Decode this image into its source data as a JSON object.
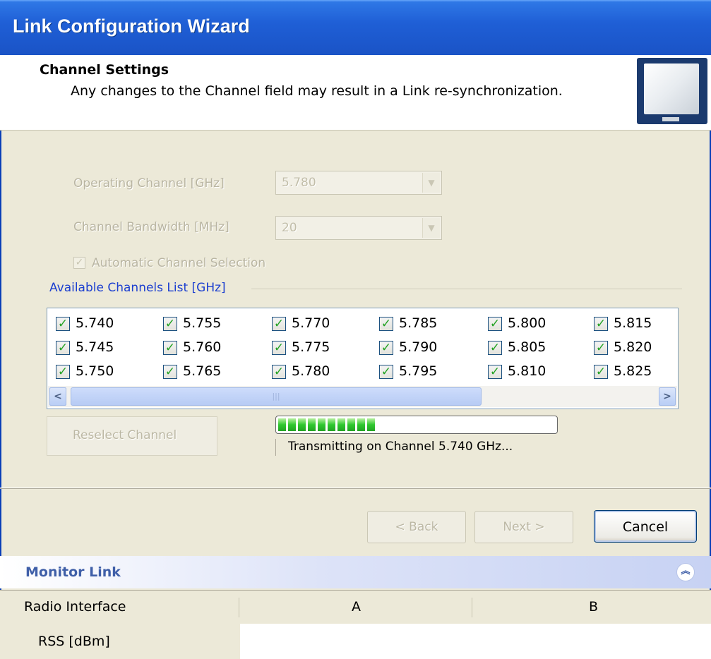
{
  "window": {
    "title": "Link Configuration Wizard"
  },
  "header": {
    "title": "Channel Settings",
    "subtitle": "Any changes to the Channel field may result in a Link re-synchronization."
  },
  "form": {
    "operating_channel_label": "Operating Channel [GHz]",
    "operating_channel_value": "5.780",
    "bandwidth_label": "Channel Bandwidth [MHz]",
    "bandwidth_value": "20",
    "auto_select_label": "Automatic Channel Selection",
    "auto_select_checked": true
  },
  "channels": {
    "group_title": "Available Channels List [GHz]",
    "items": [
      {
        "label": "5.740",
        "checked": true
      },
      {
        "label": "5.745",
        "checked": true
      },
      {
        "label": "5.750",
        "checked": true
      },
      {
        "label": "5.755",
        "checked": true
      },
      {
        "label": "5.760",
        "checked": true
      },
      {
        "label": "5.765",
        "checked": true
      },
      {
        "label": "5.770",
        "checked": true
      },
      {
        "label": "5.775",
        "checked": true
      },
      {
        "label": "5.780",
        "checked": true
      },
      {
        "label": "5.785",
        "checked": true
      },
      {
        "label": "5.790",
        "checked": true
      },
      {
        "label": "5.795",
        "checked": true
      },
      {
        "label": "5.800",
        "checked": true
      },
      {
        "label": "5.805",
        "checked": true
      },
      {
        "label": "5.810",
        "checked": true
      },
      {
        "label": "5.815",
        "checked": true
      },
      {
        "label": "5.820",
        "checked": true
      },
      {
        "label": "5.825",
        "checked": true
      }
    ]
  },
  "actions": {
    "reselect_label": "Reselect Channel",
    "progress_segments": 10,
    "status_text": "Transmitting on Channel 5.740 GHz..."
  },
  "nav": {
    "back_label": "< Back",
    "next_label": "Next >",
    "cancel_label": "Cancel"
  },
  "monitor": {
    "title": "Monitor Link",
    "columns": [
      "Radio Interface",
      "A",
      "B"
    ],
    "rows": [
      {
        "label": "RSS [dBm]"
      }
    ]
  },
  "colors": {
    "title_bar": "#1f5fd6",
    "group_title": "#1c3fd0",
    "progress": "#2fc82f",
    "monitor_title": "#3f5fa8"
  }
}
